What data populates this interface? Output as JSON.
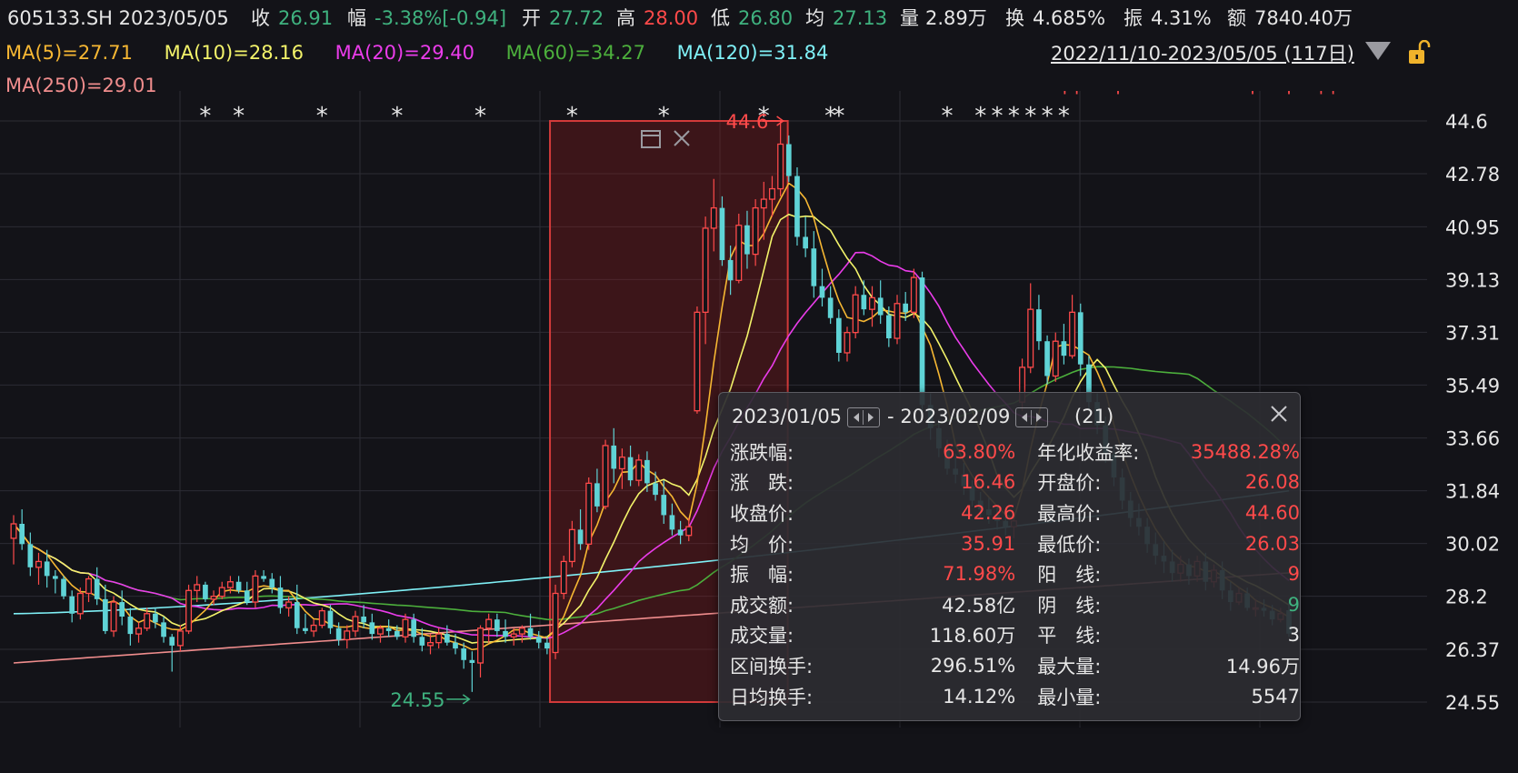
{
  "header": {
    "symbol_date": "605133.SH 2023/05/05",
    "close_label": "收",
    "close_value": "26.91",
    "change_label": "幅",
    "change_value": "-3.38%[-0.94]",
    "open_label": "开",
    "open_value": "27.72",
    "high_label": "高",
    "high_value": "28.00",
    "low_label": "低",
    "low_value": "26.80",
    "avg_label": "均",
    "avg_value": "27.13",
    "vol_label": "量",
    "vol_value": "2.89万",
    "turnover_label": "换",
    "turnover_value": "4.685%",
    "amp_label": "振",
    "amp_value": "4.31%",
    "amount_label": "额",
    "amount_value": "7840.40万"
  },
  "ma_legend": [
    {
      "text": "MA(5)=27.71",
      "color": "#f6b733"
    },
    {
      "text": "MA(10)=28.16",
      "color": "#f3f36a"
    },
    {
      "text": "MA(20)=29.40",
      "color": "#ea3cea"
    },
    {
      "text": "MA(60)=34.27",
      "color": "#4caf3c"
    },
    {
      "text": "MA(120)=31.84",
      "color": "#7ff0f6"
    },
    {
      "text": "MA(250)=29.01",
      "color": "#f08d8d"
    }
  ],
  "range_label": "2022/11/10-2023/05/05 (117日)",
  "colors": {
    "up": "#ff4a4a",
    "down": "#5fd3d6",
    "grid": "#2c2c34",
    "axis_text": "#e6e6e6",
    "lock": "#f0b32b"
  },
  "icons": {
    "lock": "lock-icon",
    "dropdown": "triangle-down-icon",
    "window": "window-icon",
    "close": "close-icon"
  },
  "chart_data": {
    "type": "candlestick",
    "ylim": [
      24.55,
      44.6
    ],
    "y_ticks": [
      "44.6",
      "42.78",
      "40.95",
      "39.13",
      "37.31",
      "35.49",
      "33.66",
      "31.84",
      "30.02",
      "28.2",
      "26.37",
      "24.55"
    ],
    "selection": {
      "start": "2023/01/05",
      "end": "2023/02/09",
      "high_label": "44.6",
      "low_label": "24.55"
    },
    "markers": [
      "*",
      "┐┐",
      "┐"
    ],
    "candles": [
      [
        30.2,
        31.0,
        29.3,
        30.7
      ],
      [
        30.7,
        31.2,
        29.8,
        30.0
      ],
      [
        30.0,
        30.4,
        28.9,
        29.2
      ],
      [
        29.2,
        29.7,
        28.6,
        29.4
      ],
      [
        29.4,
        29.8,
        28.5,
        28.9
      ],
      [
        28.9,
        29.1,
        28.3,
        28.8
      ],
      [
        28.8,
        28.9,
        28.1,
        28.2
      ],
      [
        28.2,
        28.4,
        27.3,
        27.6
      ],
      [
        27.6,
        28.5,
        27.4,
        28.3
      ],
      [
        28.3,
        28.9,
        28.0,
        28.8
      ],
      [
        28.8,
        29.2,
        27.9,
        28.1
      ],
      [
        28.1,
        28.6,
        26.9,
        27.0
      ],
      [
        27.0,
        28.2,
        26.8,
        28.0
      ],
      [
        28.0,
        28.4,
        27.2,
        27.5
      ],
      [
        27.5,
        27.8,
        26.5,
        26.9
      ],
      [
        26.9,
        27.3,
        26.6,
        27.1
      ],
      [
        27.1,
        27.8,
        27.0,
        27.6
      ],
      [
        27.6,
        27.8,
        27.1,
        27.3
      ],
      [
        27.3,
        27.5,
        26.6,
        26.8
      ],
      [
        26.8,
        26.9,
        25.6,
        26.5
      ],
      [
        26.5,
        27.2,
        26.3,
        27.0
      ],
      [
        27.0,
        28.6,
        26.9,
        28.4
      ],
      [
        28.4,
        28.9,
        28.0,
        28.6
      ],
      [
        28.6,
        28.7,
        28.0,
        28.1
      ],
      [
        28.1,
        28.4,
        27.9,
        28.2
      ],
      [
        28.2,
        28.7,
        28.1,
        28.5
      ],
      [
        28.5,
        28.9,
        28.3,
        28.7
      ],
      [
        28.7,
        28.9,
        28.3,
        28.4
      ],
      [
        28.4,
        28.7,
        27.9,
        28.0
      ],
      [
        28.0,
        29.1,
        27.8,
        28.9
      ],
      [
        28.9,
        29.1,
        28.7,
        28.8
      ],
      [
        28.8,
        29.0,
        28.3,
        28.5
      ],
      [
        28.5,
        28.9,
        27.6,
        27.8
      ],
      [
        27.8,
        28.2,
        27.5,
        28.0
      ],
      [
        28.0,
        28.6,
        26.9,
        27.1
      ],
      [
        27.1,
        27.6,
        26.9,
        27.0
      ],
      [
        27.0,
        27.4,
        26.8,
        27.2
      ],
      [
        27.2,
        27.8,
        27.1,
        27.7
      ],
      [
        27.7,
        27.9,
        26.9,
        27.1
      ],
      [
        27.1,
        27.3,
        26.5,
        26.7
      ],
      [
        26.7,
        27.2,
        26.4,
        27.0
      ],
      [
        27.0,
        27.7,
        26.8,
        27.5
      ],
      [
        27.5,
        27.9,
        27.1,
        27.3
      ],
      [
        27.3,
        27.6,
        26.7,
        26.9
      ],
      [
        26.9,
        27.2,
        26.6,
        27.1
      ],
      [
        27.1,
        27.4,
        26.8,
        27.0
      ],
      [
        27.0,
        27.2,
        26.7,
        26.8
      ],
      [
        26.8,
        27.6,
        26.6,
        27.4
      ],
      [
        27.4,
        27.6,
        26.6,
        26.8
      ],
      [
        26.8,
        27.1,
        26.3,
        26.5
      ],
      [
        26.5,
        26.9,
        26.2,
        26.6
      ],
      [
        26.6,
        27.1,
        26.4,
        26.9
      ],
      [
        26.9,
        27.2,
        26.5,
        26.6
      ],
      [
        26.6,
        26.9,
        26.2,
        26.4
      ],
      [
        26.4,
        26.6,
        25.7,
        26.0
      ],
      [
        26.0,
        26.3,
        24.9,
        25.9
      ],
      [
        25.9,
        27.2,
        25.4,
        27.1
      ],
      [
        27.1,
        27.6,
        26.6,
        27.4
      ],
      [
        27.4,
        27.6,
        26.8,
        27.0
      ],
      [
        27.0,
        27.4,
        26.6,
        26.8
      ],
      [
        26.8,
        27.1,
        26.5,
        26.9
      ],
      [
        26.9,
        27.2,
        26.6,
        27.1
      ],
      [
        27.1,
        27.6,
        26.7,
        26.8
      ],
      [
        26.8,
        27.0,
        26.4,
        26.6
      ],
      [
        26.6,
        26.8,
        26.2,
        26.4
      ],
      [
        26.26,
        28.6,
        26.03,
        28.3
      ],
      [
        28.3,
        29.6,
        28.1,
        29.4
      ],
      [
        29.4,
        30.8,
        29.2,
        30.5
      ],
      [
        30.5,
        31.2,
        29.8,
        30.0
      ],
      [
        30.0,
        32.3,
        29.8,
        32.1
      ],
      [
        32.1,
        32.6,
        31.1,
        31.3
      ],
      [
        31.3,
        33.6,
        31.2,
        33.4
      ],
      [
        33.4,
        34.0,
        32.1,
        32.6
      ],
      [
        32.6,
        33.3,
        31.9,
        33.0
      ],
      [
        33.0,
        33.4,
        32.0,
        32.2
      ],
      [
        32.2,
        33.1,
        32.0,
        32.9
      ],
      [
        32.9,
        33.2,
        31.8,
        32.1
      ],
      [
        32.1,
        32.5,
        31.5,
        31.7
      ],
      [
        31.7,
        32.2,
        30.7,
        31.0
      ],
      [
        31.0,
        31.4,
        30.3,
        30.5
      ],
      [
        30.5,
        30.8,
        30.0,
        30.3
      ],
      [
        30.3,
        30.9,
        30.1,
        30.6
      ],
      [
        34.6,
        38.2,
        34.5,
        38.0
      ],
      [
        38.0,
        41.3,
        36.9,
        40.9
      ],
      [
        40.9,
        42.6,
        40.1,
        41.6
      ],
      [
        41.6,
        42.0,
        39.6,
        39.8
      ],
      [
        39.8,
        40.3,
        38.6,
        39.1
      ],
      [
        39.1,
        41.4,
        39.0,
        41.0
      ],
      [
        41.0,
        41.5,
        39.5,
        40.0
      ],
      [
        40.0,
        41.9,
        39.6,
        41.6
      ],
      [
        41.6,
        42.5,
        40.5,
        41.9
      ],
      [
        41.9,
        42.7,
        41.3,
        42.26
      ],
      [
        42.26,
        44.6,
        42.0,
        43.8
      ],
      [
        43.8,
        44.1,
        42.5,
        42.7
      ],
      [
        42.7,
        43.0,
        40.3,
        40.6
      ],
      [
        40.6,
        41.3,
        39.9,
        40.2
      ],
      [
        40.2,
        40.8,
        38.5,
        38.9
      ],
      [
        38.9,
        39.5,
        38.2,
        38.5
      ],
      [
        38.5,
        38.9,
        37.6,
        37.8
      ],
      [
        37.8,
        38.1,
        36.3,
        36.6
      ],
      [
        36.6,
        37.5,
        36.3,
        37.3
      ],
      [
        37.3,
        38.9,
        37.1,
        38.6
      ],
      [
        38.6,
        39.1,
        37.9,
        38.1
      ],
      [
        38.1,
        38.9,
        37.5,
        38.5
      ],
      [
        38.5,
        39.1,
        37.6,
        37.9
      ],
      [
        37.9,
        38.2,
        36.8,
        37.1
      ],
      [
        37.1,
        38.6,
        36.9,
        38.3
      ],
      [
        38.3,
        38.7,
        37.7,
        38.0
      ],
      [
        38.0,
        39.5,
        37.8,
        39.2
      ],
      [
        39.2,
        39.4,
        34.5,
        34.8
      ],
      [
        34.8,
        35.2,
        33.6,
        34.0
      ],
      [
        34.0,
        34.3,
        33.0,
        33.3
      ],
      [
        33.3,
        33.6,
        32.4,
        32.6
      ],
      [
        32.6,
        33.1,
        32.1,
        32.4
      ],
      [
        32.4,
        32.8,
        31.7,
        32.0
      ],
      [
        32.0,
        32.2,
        31.3,
        31.5
      ],
      [
        31.5,
        31.8,
        30.9,
        31.2
      ],
      [
        31.2,
        31.6,
        30.7,
        31.0
      ],
      [
        31.0,
        31.3,
        30.5,
        30.8
      ],
      [
        30.8,
        31.2,
        30.3,
        30.6
      ],
      [
        30.6,
        31.0,
        30.2,
        30.8
      ],
      [
        34.9,
        36.4,
        34.6,
        36.1
      ],
      [
        36.1,
        39.0,
        35.9,
        38.1
      ],
      [
        38.1,
        38.6,
        36.7,
        37.0
      ],
      [
        37.0,
        37.2,
        35.5,
        35.8
      ],
      [
        35.8,
        37.3,
        35.6,
        37.0
      ],
      [
        37.0,
        37.6,
        36.2,
        36.5
      ],
      [
        36.5,
        38.6,
        36.4,
        38.0
      ],
      [
        38.0,
        38.3,
        35.8,
        36.2
      ],
      [
        36.2,
        36.5,
        34.6,
        34.9
      ],
      [
        34.9,
        35.2,
        33.8,
        34.1
      ],
      [
        34.1,
        34.4,
        32.8,
        33.1
      ],
      [
        33.1,
        33.4,
        32.0,
        32.3
      ],
      [
        32.3,
        32.6,
        31.2,
        31.5
      ],
      [
        31.5,
        31.8,
        30.6,
        30.9
      ],
      [
        30.9,
        31.4,
        30.3,
        30.6
      ],
      [
        30.6,
        30.9,
        29.7,
        30.0
      ],
      [
        30.0,
        30.4,
        29.3,
        29.6
      ],
      [
        29.6,
        30.1,
        29.0,
        29.4
      ],
      [
        29.4,
        29.8,
        28.7,
        29.0
      ],
      [
        29.0,
        29.6,
        28.7,
        29.3
      ],
      [
        29.3,
        29.5,
        28.6,
        28.9
      ],
      [
        28.9,
        29.6,
        28.7,
        29.4
      ],
      [
        29.4,
        29.7,
        28.4,
        28.7
      ],
      [
        28.7,
        29.3,
        28.5,
        29.1
      ],
      [
        29.1,
        29.4,
        28.1,
        28.4
      ],
      [
        28.4,
        28.7,
        27.7,
        28.0
      ],
      [
        28.0,
        28.5,
        27.9,
        28.3
      ],
      [
        28.3,
        28.5,
        27.7,
        27.8
      ],
      [
        27.8,
        28.1,
        27.5,
        27.8
      ],
      [
        27.8,
        28.1,
        27.5,
        27.7
      ],
      [
        27.7,
        27.9,
        27.2,
        27.4
      ],
      [
        27.4,
        27.8,
        27.3,
        27.6
      ],
      [
        27.72,
        28.0,
        26.8,
        26.91
      ]
    ]
  },
  "popup": {
    "start_date": "2023/01/05",
    "sep": "-",
    "end_date": "2023/02/09",
    "count": "(21)",
    "rows": [
      {
        "k1": "涨跌幅:",
        "v1": "63.80%",
        "c1": "#ff4a4a",
        "k2": "年化收益率:",
        "v2": "35488.28%",
        "c2": "#ff4a4a"
      },
      {
        "k1": "涨　跌:",
        "v1": "16.46",
        "c1": "#ff4a4a",
        "k2": "开盘价:",
        "v2": "26.08",
        "c2": "#ff4a4a"
      },
      {
        "k1": "收盘价:",
        "v1": "42.26",
        "c1": "#ff4a4a",
        "k2": "最高价:",
        "v2": "44.60",
        "c2": "#ff4a4a"
      },
      {
        "k1": "均　价:",
        "v1": "35.91",
        "c1": "#ff4a4a",
        "k2": "最低价:",
        "v2": "26.03",
        "c2": "#ff4a4a"
      },
      {
        "k1": "振　幅:",
        "v1": "71.98%",
        "c1": "#ff4a4a",
        "k2": "阳　线:",
        "v2": "9",
        "c2": "#ff4a4a"
      },
      {
        "k1": "成交额:",
        "v1": "42.58亿",
        "c1": "#e6e6e6",
        "k2": "阴　线:",
        "v2": "9",
        "c2": "#3fb27f"
      },
      {
        "k1": "成交量:",
        "v1": "118.60万",
        "c1": "#e6e6e6",
        "k2": "平　线:",
        "v2": "3",
        "c2": "#e6e6e6"
      },
      {
        "k1": "区间换手:",
        "v1": "296.51%",
        "c1": "#e6e6e6",
        "k2": "最大量:",
        "v2": "14.96万",
        "c2": "#e6e6e6"
      },
      {
        "k1": "日均换手:",
        "v1": "14.12%",
        "c1": "#e6e6e6",
        "k2": "最小量:",
        "v2": "5547",
        "c2": "#e6e6e6"
      }
    ]
  }
}
